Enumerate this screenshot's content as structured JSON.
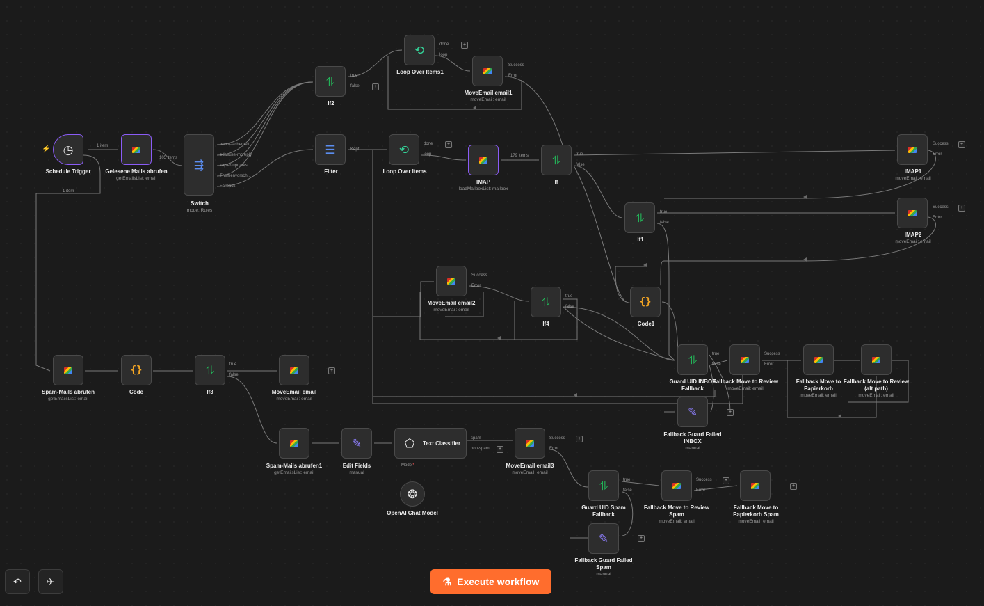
{
  "nodes": {
    "schedule_trigger": {
      "title": "Schedule Trigger"
    },
    "gelesene": {
      "title": "Gelesene Mails abrufen",
      "sub": "getEmailsList: email"
    },
    "switch": {
      "title": "Switch",
      "sub": "mode: Rules",
      "outputs": [
        "brevo-sicherheit",
        "edaeuse-mcreply",
        "zapier-updates",
        "Themenvorsch...",
        "Fallback"
      ]
    },
    "if2": {
      "title": "If2",
      "outputs": [
        "true",
        "false"
      ]
    },
    "loop1": {
      "title": "Loop Over Items1",
      "outputs": [
        "done",
        "loop"
      ]
    },
    "move1": {
      "title": "MoveEmail email1",
      "sub": "moveEmail: email",
      "outputs": [
        "Success",
        "Error"
      ]
    },
    "filter": {
      "title": "Filter",
      "outputs": [
        "Kept"
      ]
    },
    "loop": {
      "title": "Loop Over Items",
      "outputs": [
        "done",
        "loop"
      ]
    },
    "imap": {
      "title": "IMAP",
      "sub": "loadMailboxList: mailbox"
    },
    "if": {
      "title": "If",
      "outputs": [
        "true",
        "false"
      ]
    },
    "imap1": {
      "title": "IMAP1",
      "sub": "moveEmail: email",
      "outputs": [
        "Success",
        "Error"
      ]
    },
    "imap2": {
      "title": "IMAP2",
      "sub": "moveEmail: email",
      "outputs": [
        "Success",
        "Error"
      ]
    },
    "if1": {
      "title": "If1",
      "outputs": [
        "true",
        "false"
      ]
    },
    "code1": {
      "title": "Code1"
    },
    "move2": {
      "title": "MoveEmail email2",
      "sub": "moveEmail: email",
      "outputs": [
        "Success",
        "Error"
      ]
    },
    "if4": {
      "title": "If4",
      "outputs": [
        "true",
        "false"
      ]
    },
    "guard_inbox": {
      "title": "Guard UID INBOX",
      "title2": "Fallback",
      "outputs": [
        "true",
        "false"
      ]
    },
    "fb_review": {
      "title": "Fallback Move to Review",
      "sub": "moveEmail: email",
      "outputs": [
        "Success",
        "Error"
      ]
    },
    "fb_papier": {
      "title": "Fallback Move to",
      "title2": "Papierkorb",
      "sub": "moveEmail: email"
    },
    "fb_review_alt": {
      "title": "Fallback Move to Review",
      "title2": "(alt path)",
      "sub": "moveEmail: email"
    },
    "fb_guard_inbox": {
      "title": "Fallback Guard Failed",
      "title2": "INBOX",
      "sub": "manual"
    },
    "spam_mails": {
      "title": "Spam-Mails abrufen",
      "sub": "getEmailsList: email"
    },
    "code": {
      "title": "Code"
    },
    "if3": {
      "title": "If3",
      "outputs": [
        "true",
        "false"
      ]
    },
    "move_email": {
      "title": "MoveEmail email",
      "sub": "moveEmail: email"
    },
    "spam_mails1": {
      "title": "Spam-Mails abrufen1",
      "sub": "getEmailsList: email"
    },
    "edit_fields": {
      "title": "Edit Fields",
      "sub": "manual"
    },
    "text_classifier": {
      "title": "Text Classifier",
      "outputs": [
        "spam",
        "non-spam"
      ],
      "model_label": "Model",
      "model_required": "*"
    },
    "openai": {
      "title": "OpenAI Chat Model"
    },
    "move3": {
      "title": "MoveEmail email3",
      "sub": "moveEmail: email",
      "outputs": [
        "Success",
        "Error"
      ]
    },
    "guard_spam": {
      "title": "Guard UID Spam",
      "title2": "Fallback",
      "outputs": [
        "true",
        "false"
      ]
    },
    "fb_review_spam": {
      "title": "Fallback Move to Review",
      "title2": "Spam",
      "sub": "moveEmail: email",
      "outputs": [
        "Success",
        "Error"
      ]
    },
    "fb_papier_spam": {
      "title": "Fallback Move to",
      "title2": "Papierkorb Spam",
      "sub": "moveEmail: email"
    },
    "fb_guard_spam": {
      "title": "Fallback Guard Failed",
      "title2": "Spam",
      "sub": "manual"
    }
  },
  "edge_labels": {
    "trigger_gelesene": "1 item",
    "gelesene_switch": "105 items",
    "imap_if": "179 items",
    "trigger_spam": "1 item"
  },
  "icons": {
    "trigger": "clock-icon",
    "imap": "envelope-icon",
    "if": "branch-icon",
    "loop": "loop-icon",
    "filter": "filter-icon",
    "code": "braces-icon",
    "edit": "pencil-icon",
    "classifier": "tag-icon",
    "model": "openai-icon"
  },
  "toolbar": {
    "execute_label": "Execute workflow"
  },
  "colors": {
    "accent": "#ff6d2d",
    "if_icon": "#22c55e",
    "selected_border": "#8b5cf6",
    "canvas_bg": "#1b1b1b"
  }
}
